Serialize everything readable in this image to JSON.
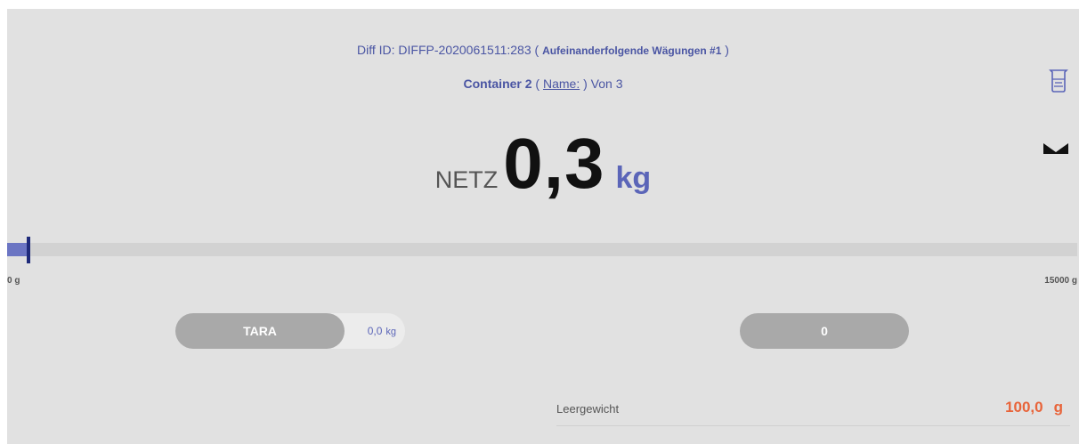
{
  "header": {
    "diff_id": "Diff ID: DIFFP-2020061511:283",
    "diff_sub_open": "( ",
    "diff_sub": "Aufeinanderfolgende Wägungen #1",
    "diff_sub_close": " )",
    "container_label": "Container 2",
    "name_open": "( ",
    "name_link": "Name:",
    "name_close": " ) Von 3"
  },
  "icons": {
    "beaker": "beaker-icon",
    "collapse": "chevron-collapse-icon"
  },
  "reading": {
    "mode": "NETZ",
    "value": "0,3",
    "unit": "kg"
  },
  "scale": {
    "min_label": "0 g",
    "max_label": "15000 g",
    "progress_fraction": 0.02
  },
  "tara": {
    "button_label": "TARA",
    "value": "0,0",
    "unit": "kg"
  },
  "counter": {
    "label": "0"
  },
  "empty_weight": {
    "label": "Leergewicht",
    "value": "100,0",
    "unit": "g"
  },
  "colors": {
    "accent": "#5b65b8",
    "link_text": "#4a55a3",
    "button_gray": "#a9a9a9",
    "highlight_value": "#e8643a",
    "background": "#e1e1e1"
  }
}
